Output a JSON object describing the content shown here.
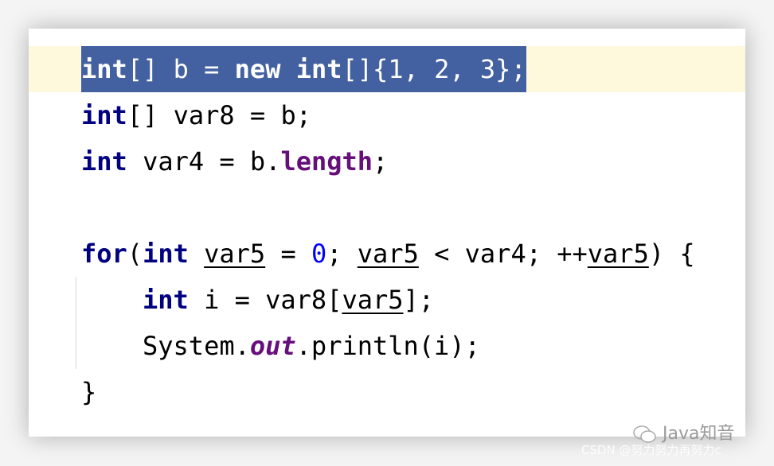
{
  "editor": {
    "lines": [
      {
        "current": true,
        "selected": true,
        "indent": 0,
        "tokens": [
          {
            "t": "int",
            "c": "kw"
          },
          {
            "t": "[] b = ",
            "c": ""
          },
          {
            "t": "new",
            "c": "kw"
          },
          {
            "t": " ",
            "c": ""
          },
          {
            "t": "int",
            "c": "kw"
          },
          {
            "t": "[]{1, 2, 3};",
            "c": ""
          }
        ]
      },
      {
        "indent": 0,
        "tokens": [
          {
            "t": "int",
            "c": "kw"
          },
          {
            "t": "[] var8 = b;",
            "c": ""
          }
        ]
      },
      {
        "indent": 0,
        "tokens": [
          {
            "t": "int",
            "c": "kw"
          },
          {
            "t": " var4 = b.",
            "c": ""
          },
          {
            "t": "length",
            "c": "field"
          },
          {
            "t": ";",
            "c": ""
          }
        ]
      },
      {
        "indent": 0,
        "tokens": []
      },
      {
        "indent": 0,
        "tokens": [
          {
            "t": "for",
            "c": "kw"
          },
          {
            "t": "(",
            "c": ""
          },
          {
            "t": "int",
            "c": "kw"
          },
          {
            "t": " ",
            "c": ""
          },
          {
            "t": "var5",
            "c": "ul"
          },
          {
            "t": " = ",
            "c": ""
          },
          {
            "t": "0",
            "c": "num"
          },
          {
            "t": "; ",
            "c": ""
          },
          {
            "t": "var5",
            "c": "ul"
          },
          {
            "t": " < var4; ++",
            "c": ""
          },
          {
            "t": "var5",
            "c": "ul"
          },
          {
            "t": ") {",
            "c": ""
          }
        ]
      },
      {
        "indent": 1,
        "tokens": [
          {
            "t": "int",
            "c": "kw"
          },
          {
            "t": " i = var8[",
            "c": ""
          },
          {
            "t": "var5",
            "c": "ul"
          },
          {
            "t": "];",
            "c": ""
          }
        ]
      },
      {
        "indent": 1,
        "tokens": [
          {
            "t": "System.",
            "c": ""
          },
          {
            "t": "out",
            "c": "sfield"
          },
          {
            "t": ".println(i);",
            "c": ""
          }
        ]
      },
      {
        "indent": 0,
        "tokens": [
          {
            "t": "}",
            "c": ""
          }
        ]
      }
    ]
  },
  "colors": {
    "keyword": "#000080",
    "field": "#660e7a",
    "number": "#0000ff",
    "selection": "#4360a0",
    "current_line": "#fef9dc"
  },
  "watermark": {
    "icon": "wechat-icon",
    "text": "Java知音",
    "csdn": "CSDN @努力努力再努力c"
  }
}
